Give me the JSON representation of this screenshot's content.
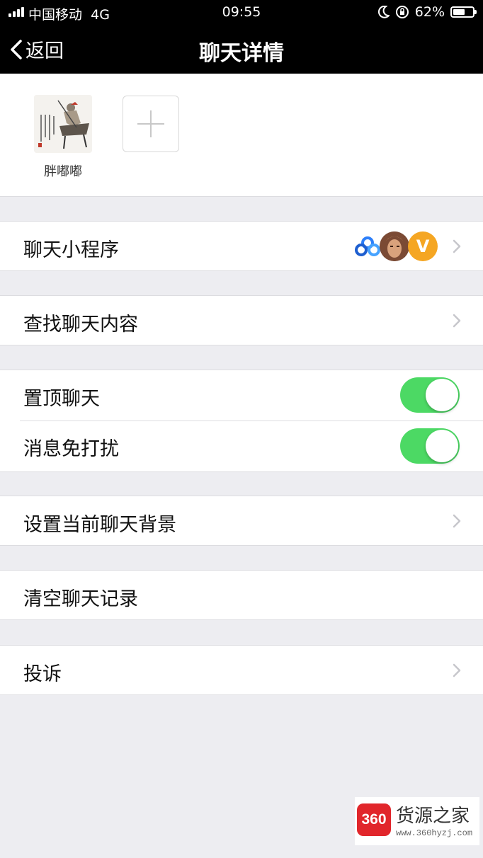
{
  "status_bar": {
    "carrier": "中国移动",
    "network": "4G",
    "time": "09:55",
    "battery": "62%",
    "battery_level": 0.62
  },
  "nav": {
    "back_label": "返回",
    "title": "聊天详情"
  },
  "members": [
    {
      "name": "胖嘟嘟"
    }
  ],
  "cells": {
    "mini_programs": "聊天小程序",
    "mini_program_badge": "V",
    "search_chat": "查找聊天内容",
    "sticky_chat": "置顶聊天",
    "mute": "消息免打扰",
    "chat_background": "设置当前聊天背景",
    "clear_history": "清空聊天记录",
    "report": "投诉"
  },
  "toggles": {
    "sticky_chat_on": true,
    "mute_on": true
  },
  "watermark": {
    "badge": "360",
    "title": "货源之家",
    "url": "www.360hyzj.com"
  },
  "colors": {
    "toggle_on": "#4cd964",
    "watermark_red": "#e1262b",
    "background": "#ededf1"
  }
}
